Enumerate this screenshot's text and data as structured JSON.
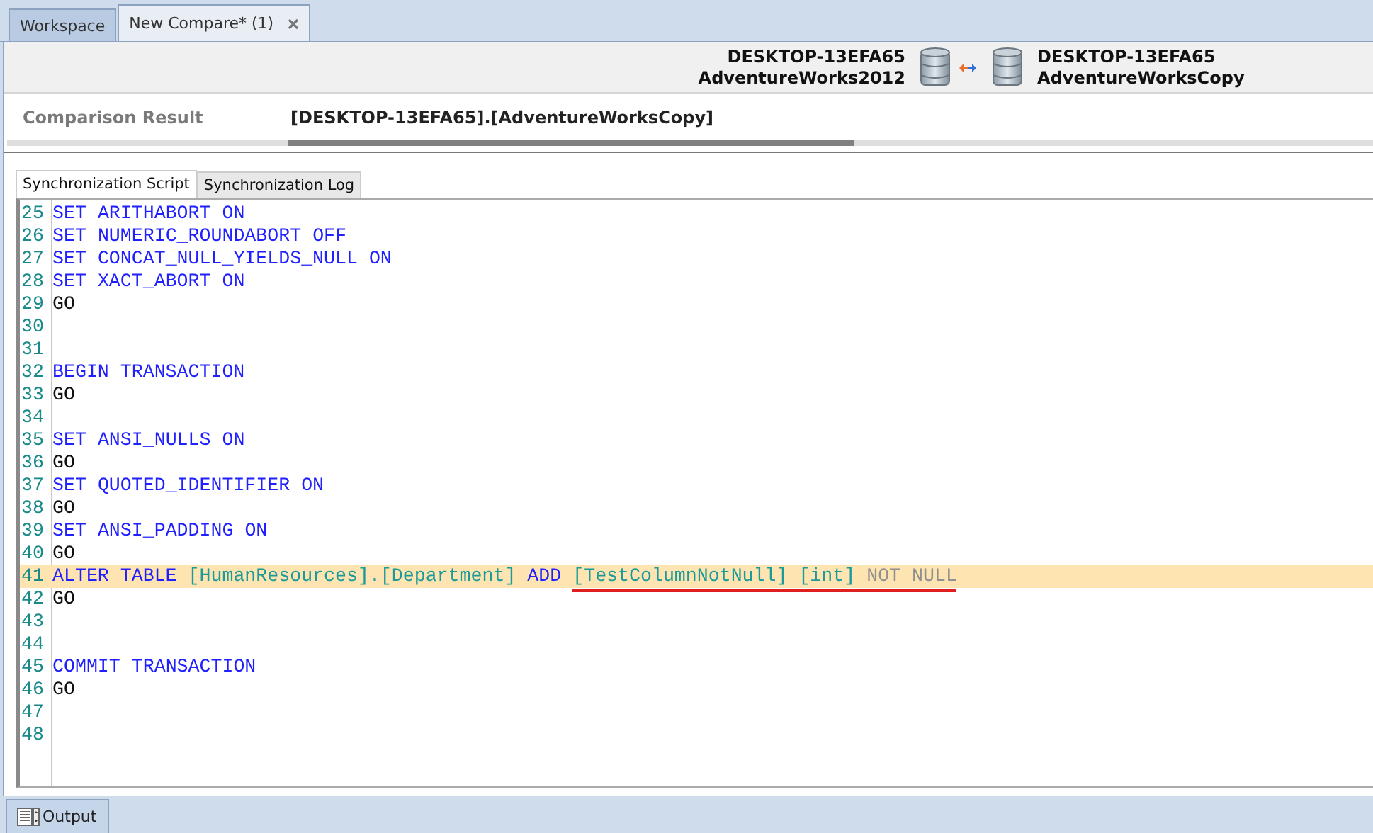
{
  "document_tabs": [
    {
      "label": "Workspace",
      "selected": false
    },
    {
      "label": "New Compare* (1)",
      "selected": true,
      "closable": true
    }
  ],
  "header": {
    "source": {
      "server": "DESKTOP-13EFA65",
      "database": "AdventureWorks2012"
    },
    "target": {
      "server": "DESKTOP-13EFA65",
      "database": "AdventureWorksCopy"
    }
  },
  "comparison": {
    "label": "Comparison Result",
    "value": "[DESKTOP-13EFA65].[AdventureWorksCopy]"
  },
  "script_tabs": [
    {
      "label": "Synchronization Script",
      "selected": true
    },
    {
      "label": "Synchronization Log",
      "selected": false
    }
  ],
  "code_lines": [
    {
      "number": "25",
      "tokens": [
        {
          "text": "SET",
          "kind": "keyword"
        },
        {
          "text": "ARITHABORT",
          "kind": "keyword"
        },
        {
          "text": "ON",
          "kind": "keyword"
        }
      ]
    },
    {
      "number": "26",
      "tokens": [
        {
          "text": "SET",
          "kind": "keyword"
        },
        {
          "text": "NUMERIC_ROUNDABORT",
          "kind": "keyword"
        },
        {
          "text": "OFF",
          "kind": "keyword"
        }
      ]
    },
    {
      "number": "27",
      "tokens": [
        {
          "text": "SET",
          "kind": "keyword"
        },
        {
          "text": "CONCAT_NULL_YIELDS_NULL",
          "kind": "keyword"
        },
        {
          "text": "ON",
          "kind": "keyword"
        }
      ]
    },
    {
      "number": "28",
      "tokens": [
        {
          "text": "SET",
          "kind": "keyword"
        },
        {
          "text": "XACT_ABORT",
          "kind": "keyword"
        },
        {
          "text": "ON",
          "kind": "keyword"
        }
      ]
    },
    {
      "number": "29",
      "tokens": [
        {
          "text": "GO",
          "kind": "plain"
        }
      ]
    },
    {
      "number": "30"
    },
    {
      "number": "31"
    },
    {
      "number": "32",
      "tokens": [
        {
          "text": "BEGIN",
          "kind": "keyword"
        },
        {
          "text": "TRANSACTION",
          "kind": "keyword"
        }
      ]
    },
    {
      "number": "33",
      "tokens": [
        {
          "text": "GO",
          "kind": "plain"
        }
      ]
    },
    {
      "number": "34"
    },
    {
      "number": "35",
      "tokens": [
        {
          "text": "SET",
          "kind": "keyword"
        },
        {
          "text": "ANSI_NULLS",
          "kind": "keyword"
        },
        {
          "text": "ON",
          "kind": "keyword"
        }
      ]
    },
    {
      "number": "36",
      "tokens": [
        {
          "text": "GO",
          "kind": "plain"
        }
      ]
    },
    {
      "number": "37",
      "tokens": [
        {
          "text": "SET",
          "kind": "keyword"
        },
        {
          "text": "QUOTED_IDENTIFIER",
          "kind": "keyword"
        },
        {
          "text": "ON",
          "kind": "keyword"
        }
      ]
    },
    {
      "number": "38",
      "tokens": [
        {
          "text": "GO",
          "kind": "plain"
        }
      ]
    },
    {
      "number": "39",
      "tokens": [
        {
          "text": "SET",
          "kind": "keyword"
        },
        {
          "text": "ANSI_PADDING",
          "kind": "keyword"
        },
        {
          "text": "ON",
          "kind": "keyword"
        }
      ]
    },
    {
      "number": "40",
      "tokens": [
        {
          "text": "GO",
          "kind": "plain"
        }
      ]
    },
    {
      "number": "41",
      "highlighted": true,
      "tokens": [
        {
          "text": "ALTER",
          "kind": "keyword"
        },
        {
          "text": "TABLE",
          "kind": "keyword"
        },
        {
          "text": "[HumanResources].[Department]",
          "kind": "identifier"
        },
        {
          "text": "ADD",
          "kind": "keyword"
        },
        {
          "text": "[TestColumnNotNull]",
          "kind": "identifier",
          "underlined": true
        },
        {
          "text": "[int]",
          "kind": "identifier",
          "underlined": true
        },
        {
          "text": "NOT NULL",
          "kind": "muted",
          "underlined": true
        }
      ]
    },
    {
      "number": "42",
      "tokens": [
        {
          "text": "GO",
          "kind": "plain"
        }
      ]
    },
    {
      "number": "43"
    },
    {
      "number": "44"
    },
    {
      "number": "45",
      "tokens": [
        {
          "text": "COMMIT",
          "kind": "keyword"
        },
        {
          "text": "TRANSACTION",
          "kind": "keyword"
        }
      ]
    },
    {
      "number": "46",
      "tokens": [
        {
          "text": "GO",
          "kind": "plain"
        }
      ]
    },
    {
      "number": "47"
    },
    {
      "number": "48"
    }
  ],
  "bottom_tabs": [
    {
      "label": "Output",
      "selected": false
    }
  ]
}
